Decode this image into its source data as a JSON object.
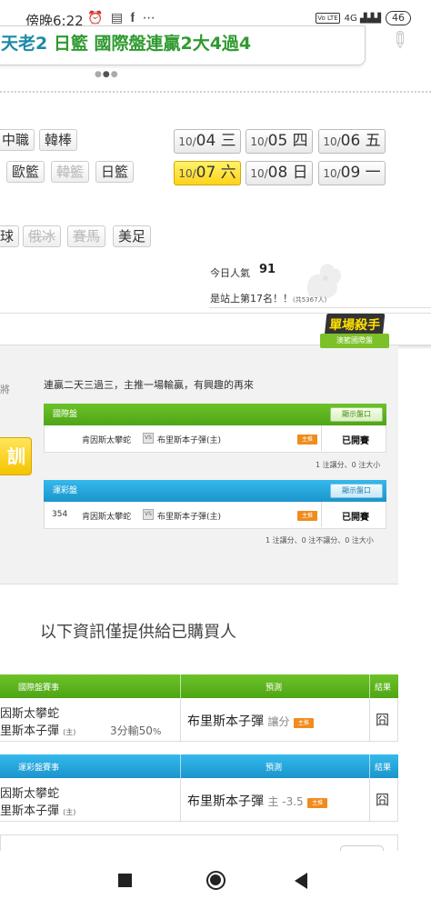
{
  "status_bar": {
    "time": "傍晚6:22",
    "icons": "⏰ ▤ 𝐟 ⋯",
    "volte": "Vo LTE",
    "signal": "4G ▟▟▟",
    "battery": "46"
  },
  "banner": {
    "prefix": "天老2",
    "text": "日籃 國際盤連贏2大4過4"
  },
  "categories": [
    {
      "label": "中職",
      "muted": false
    },
    {
      "label": "韓棒",
      "muted": false
    },
    {
      "label": "歐籃",
      "muted": false
    },
    {
      "label": "韓籃",
      "muted": true
    },
    {
      "label": "日籃",
      "muted": false
    },
    {
      "label": "球",
      "muted": false
    },
    {
      "label": "俄冰",
      "muted": true
    },
    {
      "label": "賽馬",
      "muted": true
    },
    {
      "label": "美足",
      "muted": false
    }
  ],
  "dates": [
    {
      "month": "10/",
      "day": "04",
      "weekday": "三",
      "active": false
    },
    {
      "month": "10/",
      "day": "05",
      "weekday": "四",
      "active": false
    },
    {
      "month": "10/",
      "day": "06",
      "weekday": "五",
      "active": false
    },
    {
      "month": "10/",
      "day": "07",
      "weekday": "六",
      "active": true
    },
    {
      "month": "10/",
      "day": "08",
      "weekday": "日",
      "active": false
    },
    {
      "month": "10/",
      "day": "09",
      "weekday": "一",
      "active": false
    }
  ],
  "popularity": {
    "label": "今日人氣",
    "value": "91",
    "rank": "是站上第17名！！",
    "rank_sub": "(共5367人)"
  },
  "badge": {
    "title": "單場殺手",
    "subtitle": "澳籃國際盤"
  },
  "card": {
    "left_fragment": "將",
    "yellow_btn": "訓",
    "note": "連贏二天三過三，主推一場輸贏，有興趣的再來"
  },
  "intl_panel": {
    "title": "國際盤",
    "show_btn": "顯示盤口",
    "num": "",
    "home": "肯因斯太攀蛇",
    "vs": "VS",
    "away": "布里斯本子彈(主)",
    "tag": "主推",
    "status": "已開賽",
    "summary": "1 注讓分、0 注大小"
  },
  "sports_panel": {
    "title": "運彩盤",
    "show_btn": "顯示盤口",
    "num": "354",
    "home": "肯因斯太攀蛇",
    "vs": "VS",
    "away": "布里斯本子彈(主)",
    "tag": "主推",
    "status": "已開賽",
    "summary": "1 注讓分、0 注不讓分、0 注大小"
  },
  "bought_title": "以下資訊僅提供給已購買人",
  "intl_result": {
    "h_match": "國際盤賽事",
    "h_pred": "預測",
    "h_res": "結果",
    "team1": "因斯太攀蛇",
    "team2": "里斯本子彈",
    "zhu": "(主)",
    "score": "3分輸50",
    "pct": "%",
    "pred_team": "布里斯本子彈",
    "pred_type": "讓分",
    "tag": "主推",
    "result": "囧"
  },
  "sports_result": {
    "h_match": "運彩盤賽事",
    "h_pred": "預測",
    "h_res": "結果",
    "team1": "因斯太攀蛇",
    "team2": "里斯本子彈",
    "zhu": "(主)",
    "pred_team": "布里斯本子彈",
    "pred_type": "主 -3.5",
    "tag": "主推",
    "result": "囧"
  }
}
